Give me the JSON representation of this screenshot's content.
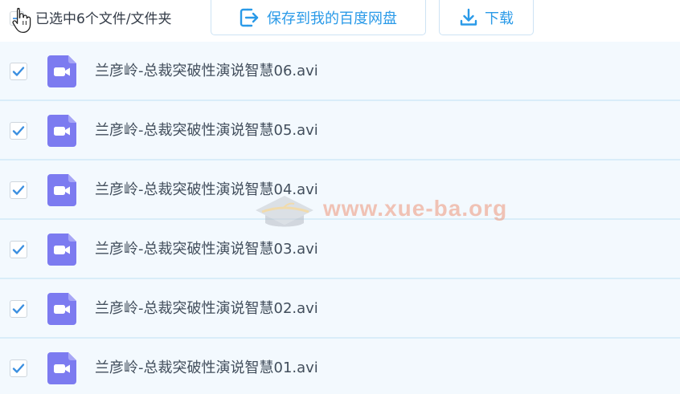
{
  "toolbar": {
    "selected_status": "已选中6个文件/文件夹",
    "save_button_label": "保存到我的百度网盘",
    "download_button_label": "下载"
  },
  "files": [
    {
      "name": "兰彦岭-总裁突破性演说智慧06.avi",
      "checked": true
    },
    {
      "name": "兰彦岭-总裁突破性演说智慧05.avi",
      "checked": true
    },
    {
      "name": "兰彦岭-总裁突破性演说智慧04.avi",
      "checked": true
    },
    {
      "name": "兰彦岭-总裁突破性演说智慧03.avi",
      "checked": true
    },
    {
      "name": "兰彦岭-总裁突破性演说智慧02.avi",
      "checked": true
    },
    {
      "name": "兰彦岭-总裁突破性演说智慧01.avi",
      "checked": true
    }
  ],
  "watermark": {
    "text": "www.xue-ba.org"
  },
  "icons": {
    "cursor": "hand-pointer-icon",
    "save": "save-to-cloud-icon",
    "download": "download-icon",
    "file": "video-file-icon",
    "check": "checkmark-icon"
  },
  "colors": {
    "accent": "#2a9ae8",
    "row_background": "#f3f9fe",
    "row_divider": "#d9edf9",
    "video_icon": "#7c7bf0",
    "check": "#3b8fe0"
  }
}
